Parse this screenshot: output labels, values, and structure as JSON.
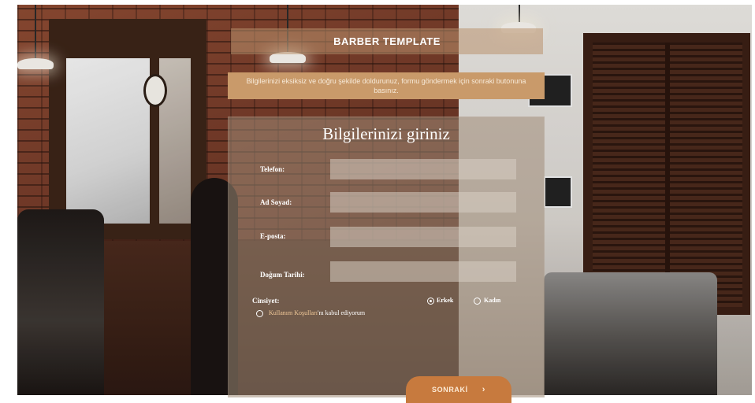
{
  "header": {
    "title": "BARBER TEMPLATE",
    "notice": "Bilgilerinizi eksiksiz ve doğru şekilde doldurunuz, formu göndermek için sonraki butonuna basınız."
  },
  "form": {
    "title": "Bilgilerinizi giriniz",
    "fields": [
      {
        "label": "Telefon:",
        "value": ""
      },
      {
        "label": "Ad Soyad:",
        "value": ""
      },
      {
        "label": "E-posta:",
        "value": ""
      },
      {
        "label": "Doğum Tarihi:",
        "value": ""
      }
    ],
    "gender": {
      "label": "Cinsiyet:",
      "options": [
        {
          "label": "Erkek",
          "selected": true
        },
        {
          "label": "Kadın",
          "selected": false
        }
      ]
    },
    "terms": {
      "link_text": "Kullanım Koşulları",
      "text": "'nı kabul ediyorum"
    },
    "next_label": "SONRAKİ",
    "next_icon": "chevron-right-icon"
  },
  "colors": {
    "accent": "#c77a3e",
    "notice_bg": "#c99a6a"
  }
}
